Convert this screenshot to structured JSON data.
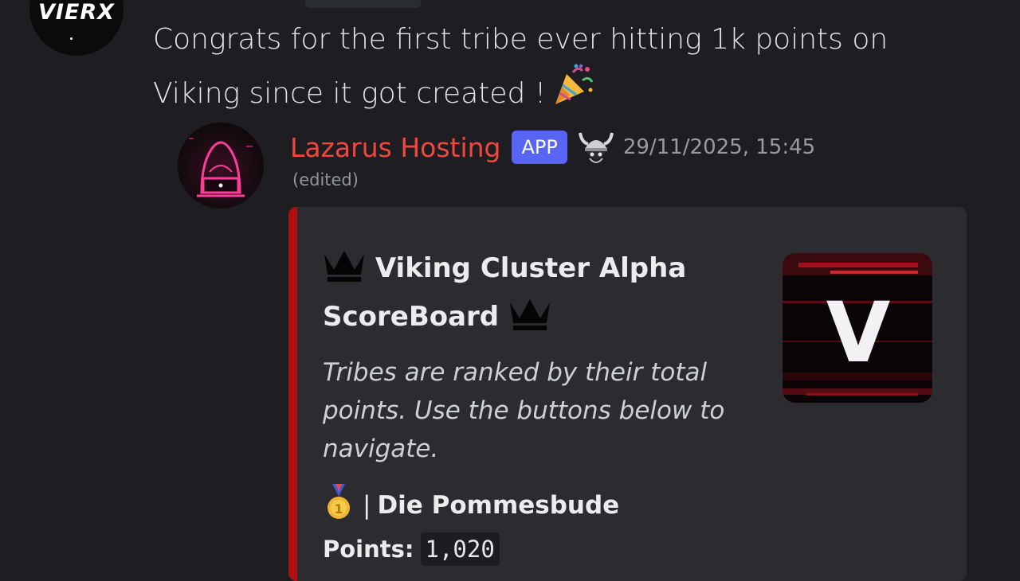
{
  "top_message": {
    "avatar_text": "VIERX",
    "text": "Congrats for the first tribe ever hitting 1k points on Viking since it got created !",
    "emoji": "party-popper"
  },
  "bot_message": {
    "author": "Lazarus Hosting",
    "badge": "APP",
    "role_icon": "viking-helmet-icon",
    "timestamp": "29/11/2025, 15:45",
    "edited": "(edited)",
    "embed": {
      "accent_color": "#b10f0f",
      "title_part1": "Viking Cluster Alpha",
      "title_part2": "ScoreBoard",
      "title_icon": "crown-icon",
      "description": "Tribes are ranked by their total points. Use the buttons below to navigate.",
      "thumbnail_letter": "V",
      "entry": {
        "rank_icon": "first-place-medal-icon",
        "separator": "|",
        "tribe": "Die Pommesbude",
        "points_label": "Points:",
        "points_value": "1,020"
      }
    }
  },
  "colors": {
    "background": "#1e1e22",
    "bot_name": "#f2473f",
    "app_badge": "#5865f2",
    "embed_bg": "#2b2b30"
  }
}
